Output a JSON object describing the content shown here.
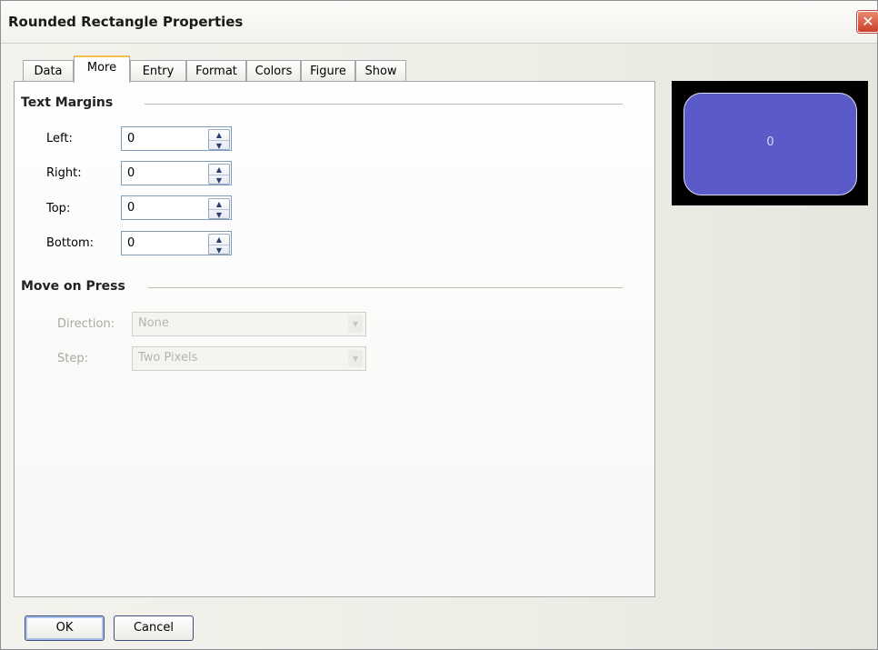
{
  "window": {
    "title": "Rounded Rectangle Properties",
    "close_glyph": "✕"
  },
  "tabs": [
    {
      "label": "Data",
      "active": false
    },
    {
      "label": "More",
      "active": true
    },
    {
      "label": "Entry",
      "active": false
    },
    {
      "label": "Format",
      "active": false
    },
    {
      "label": "Colors",
      "active": false
    },
    {
      "label": "Figure",
      "active": false
    },
    {
      "label": "Show",
      "active": false
    }
  ],
  "text_margins": {
    "title": "Text Margins",
    "left": {
      "label": "Left:",
      "value": "0"
    },
    "right": {
      "label": "Right:",
      "value": "0"
    },
    "top": {
      "label": "Top:",
      "value": "0"
    },
    "bottom": {
      "label": "Bottom:",
      "value": "0"
    }
  },
  "move_on_press": {
    "title": "Move on Press",
    "direction": {
      "label": "Direction:",
      "value": "None"
    },
    "step": {
      "label": "Step:",
      "value": "Two Pixels"
    }
  },
  "preview": {
    "text": "0",
    "fill_color": "#5a5ac9",
    "background_color": "#000000"
  },
  "buttons": {
    "ok": "OK",
    "cancel": "Cancel"
  },
  "icons": {
    "close": "close-icon",
    "spin_up": "spin-up-icon",
    "spin_down": "spin-down-icon",
    "dropdown": "chevron-down-icon"
  }
}
